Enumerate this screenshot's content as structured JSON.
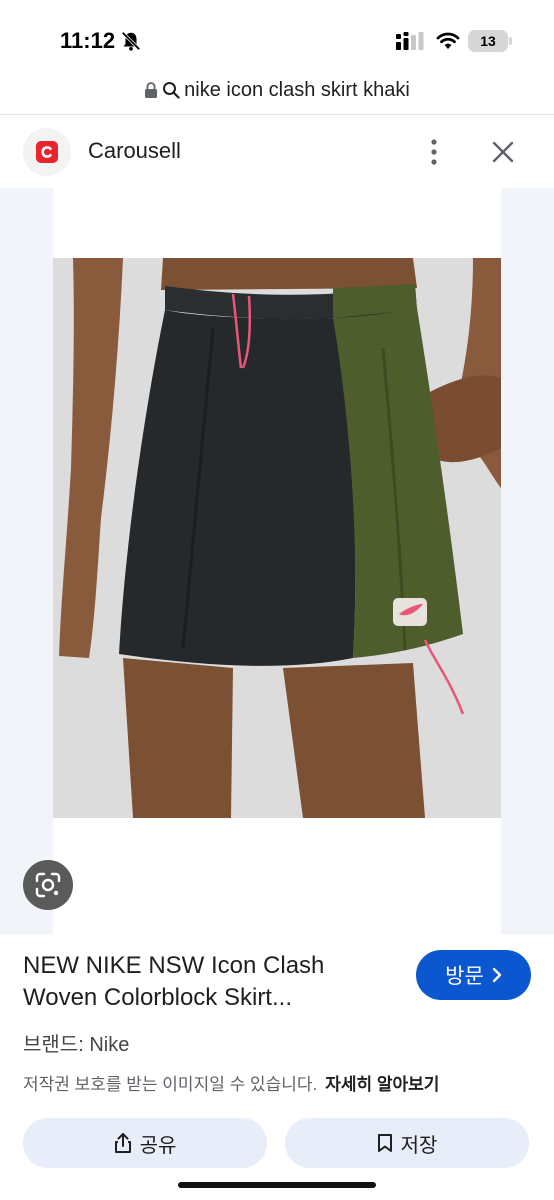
{
  "status_bar": {
    "time": "11:12",
    "battery": "13",
    "icons": [
      "bell-slash-icon",
      "signal-icon",
      "wifi-icon",
      "battery-icon"
    ]
  },
  "address_bar": {
    "query": "nike icon clash skirt khaki",
    "icons": [
      "lock-icon",
      "search-icon"
    ]
  },
  "source": {
    "name": "Carousell",
    "logo_color": "#e8242c"
  },
  "image": {
    "lens_icon": "google-lens-icon",
    "colors": {
      "left_panel": "#25292c",
      "right_panel": "#4e5d2c",
      "accent": "#e8567a"
    }
  },
  "product": {
    "title": "NEW NIKE NSW Icon Clash Woven Colorblock Skirt...",
    "visit_label": "방문",
    "brand_line": "브랜드: Nike",
    "copyright_text": "저작권 보호를 받는 이미지일 수 있습니다.",
    "learn_more_label": "자세히 알아보기"
  },
  "actions": {
    "share_label": "공유",
    "save_label": "저장"
  },
  "theme": {
    "primary": "#0b57d0",
    "tonal_button": "#e8eef9"
  }
}
